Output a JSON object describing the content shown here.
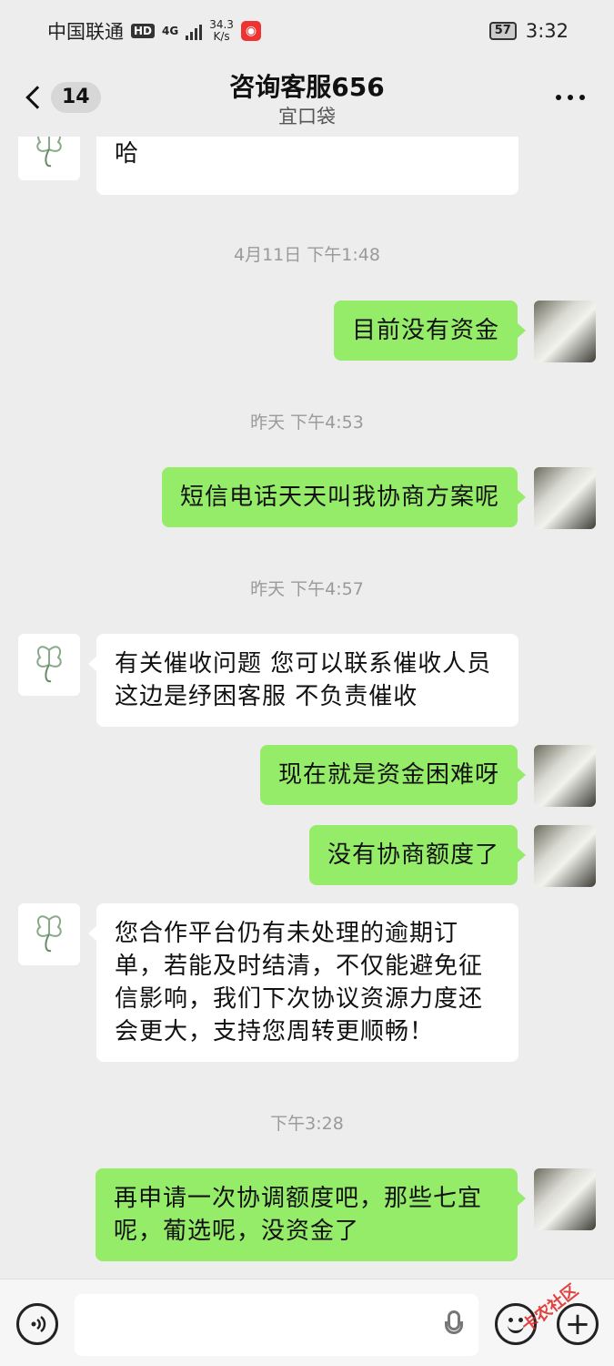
{
  "status_bar": {
    "carrier": "中国联通",
    "hd_badge": "HD",
    "network": "4G",
    "net_speed_value": "34.3",
    "net_speed_unit": "K/s",
    "battery": "57",
    "time": "3:32"
  },
  "nav": {
    "unread_count": "14",
    "title": "咨询客服656",
    "subtitle": "宜口袋"
  },
  "messages": [
    {
      "id": "m0",
      "sender": "service",
      "text": "您登录宜口袋 app 自行查看下泊日哈"
    },
    {
      "id": "t1",
      "type": "timestamp",
      "text": "4月11日 下午1:48"
    },
    {
      "id": "m1",
      "sender": "me",
      "text": "目前没有资金"
    },
    {
      "id": "t2",
      "type": "timestamp",
      "text": "昨天 下午4:53"
    },
    {
      "id": "m2",
      "sender": "me",
      "text": "短信电话天天叫我协商方案呢"
    },
    {
      "id": "t3",
      "type": "timestamp",
      "text": "昨天 下午4:57"
    },
    {
      "id": "m3",
      "sender": "service",
      "text": "有关催收问题 您可以联系催收人员 这边是纾困客服 不负责催收"
    },
    {
      "id": "m4",
      "sender": "me",
      "text": "现在就是资金困难呀"
    },
    {
      "id": "m5",
      "sender": "me",
      "text": "没有协商额度了"
    },
    {
      "id": "m6",
      "sender": "service",
      "text": "您合作平台仍有未处理的逾期订单，若能及时结清，不仅能避免征信影响，我们下次协议资源力度还会更大，支持您周转更顺畅！"
    },
    {
      "id": "t4",
      "type": "timestamp",
      "text": "下午3:28"
    },
    {
      "id": "m7",
      "sender": "me",
      "text": "再申请一次协调额度吧，那些七宜呢，葡选呢，没资金了"
    }
  ],
  "input_bar": {
    "voice_icon": "voice-icon",
    "emoji_icon": "emoji-icon",
    "plus_icon": "plus-icon",
    "mic_icon": "mic-icon"
  },
  "watermark": "卡农社区",
  "colors": {
    "background": "#ededed",
    "my_bubble": "#95ec69",
    "service_bubble": "#ffffff",
    "timestamp": "#9a9a9a"
  }
}
